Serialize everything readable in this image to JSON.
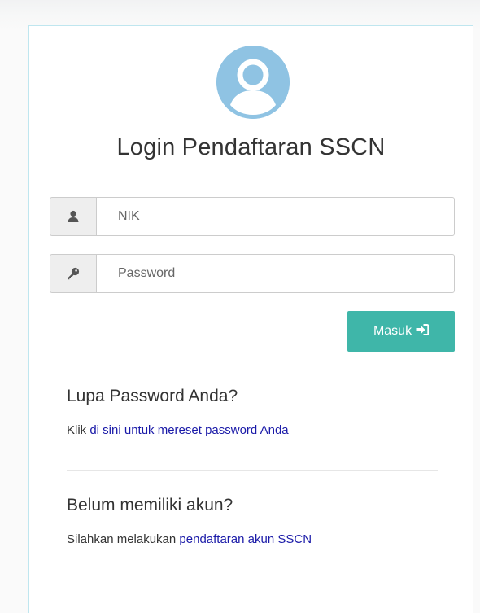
{
  "login": {
    "title": "Login Pendaftaran SSCN",
    "nik_placeholder": "NIK",
    "password_placeholder": "Password",
    "submit_label": "Masuk"
  },
  "forgot": {
    "heading": "Lupa Password Anda?",
    "prefix": "Klik",
    "link_text": "di sini untuk mereset password Anda"
  },
  "register": {
    "heading": "Belum memiliki akun?",
    "prefix": "Silahkan melakukan",
    "link_text": "pendaftaran akun SSCN"
  },
  "icons": {
    "avatar": "user-circle-icon",
    "nik": "user-icon",
    "password": "key-icon",
    "submit": "sign-in-icon"
  },
  "colors": {
    "accent_button": "#3fb6a9",
    "avatar": "#8fc3e3",
    "link": "#1a1aa8",
    "panel_border": "#bfe6ef"
  }
}
